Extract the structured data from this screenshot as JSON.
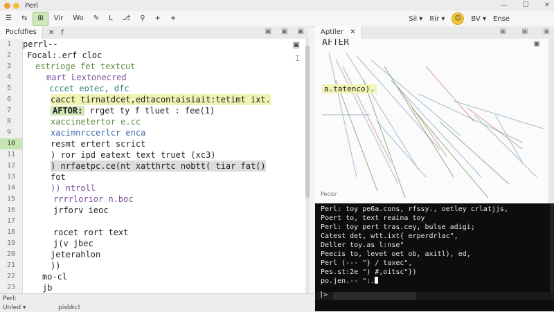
{
  "window": {
    "title": "Perl",
    "controls": [
      "—",
      "☐",
      "✕"
    ],
    "colors": {
      "close": "#f0a03a",
      "min": "#f2c23c",
      "max": "#c9c9c9"
    }
  },
  "toolbar": {
    "items": [
      "☰",
      "⇆",
      "⊞",
      "Vir",
      "Wo",
      "✎",
      "L",
      "⎇",
      "⚲",
      "+",
      "+"
    ],
    "right": [
      "Sil ▾",
      "Rir ▾",
      "BV ▾",
      "Ense"
    ],
    "coin_label": "☺"
  },
  "editor": {
    "tab_label": "Pocfdfies",
    "tab_close": "✕",
    "tab_extra": "f",
    "icons": [
      "▣",
      "▣",
      "▣"
    ],
    "side_icons": [
      "▣",
      "⌶"
    ],
    "line_numbers": [
      "1",
      "2",
      "3",
      "4",
      "5",
      "6",
      "7",
      "8",
      "9",
      "10",
      "11",
      "12",
      "13",
      "14",
      "15",
      "16",
      "17",
      "18",
      "19",
      "20",
      "21",
      "22",
      "23"
    ],
    "highlight_line": "10",
    "lines": [
      {
        "text": "perrl--"
      },
      {
        "text": "Focal:.erf cloc"
      },
      {
        "text": "estrioge fet textcut"
      },
      {
        "text": "mart  Lextonecred"
      },
      {
        "text": "cccet  eotec,  dfc"
      },
      {
        "text": "cacct tirnatdcet,edtacontaisiait:tetimt ixt."
      },
      {
        "text": "AFTOR:",
        "rest": " rrget ty f tluet : fee(1)"
      },
      {
        "text": "xaccinetertor  e.cc"
      },
      {
        "text": "xacimnrccerlcr  enca"
      },
      {
        "text": "resmt   ertert  scrict"
      },
      {
        "text": ")   ror  ipd  eatext text truet (xc3)"
      },
      {
        "text": ")  nrfaetpc.ce(nt  xatthrtc  nobtt( tiar  fat()"
      },
      {
        "text": "fot"
      },
      {
        "text": "))   ntroll"
      },
      {
        "text": "rrrrlorior  n.boc"
      },
      {
        "text": "jrforv      ieoc"
      },
      {
        "text": ""
      },
      {
        "text": "rocet      rort   text"
      },
      {
        "text": "j(v      jbec"
      },
      {
        "text": "jeterahlon"
      },
      {
        "text": "))"
      },
      {
        "text": "mo-cl"
      },
      {
        "text": "jb"
      },
      {
        "text": "))"
      }
    ]
  },
  "statusbar": {
    "left_top": "Perl:",
    "mid_top": "",
    "left_bottom": "Unled ▾",
    "mid_bottom": "pisbkcl"
  },
  "preview": {
    "tab_label": "Aptiler",
    "tab_close": "✕",
    "icons": [
      "▣",
      "▣",
      "▣",
      "▣"
    ],
    "heading": "AFTER",
    "highlight": "a.tatenco).",
    "status": "Pecis/"
  },
  "terminal": {
    "lines": [
      "Perl: toy pe6a.cons, rfssy., oetley crlatjjs,",
      "Poert to, text reaina toy",
      "Perl: toy pert tras.cey, bulse adigi;",
      "Catest det, wtt.ixt{ erperdrlac\",",
      "Deller  toy.as l:nse\"",
      "Peecis to, levet oet ob, axitl), ed,",
      "Perl (---  \"} / taxec\",",
      "Pes.st:2e  \") #,oitsc\"})",
      "po.jen.-- \":."
    ],
    "prompt": "]>"
  }
}
